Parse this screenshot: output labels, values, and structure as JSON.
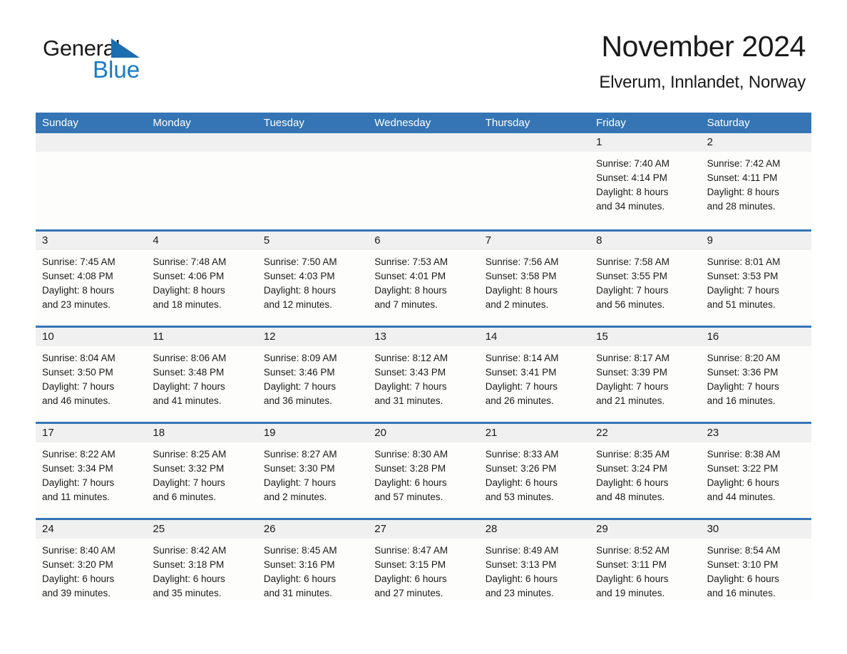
{
  "brand": {
    "name_part1": "General",
    "name_part2": "Blue",
    "accent_color": "#1b7ac4",
    "triangle_color": "#1b6fb0"
  },
  "header": {
    "title": "November 2024",
    "subtitle": "Elverum, Innlandet, Norway"
  },
  "theme": {
    "header_bar_color": "#3575b5",
    "daynum_band_color": "#f0f0f0",
    "cell_background": "#fdfdfc",
    "text_color": "#1a1a1a"
  },
  "weekdays": [
    "Sunday",
    "Monday",
    "Tuesday",
    "Wednesday",
    "Thursday",
    "Friday",
    "Saturday"
  ],
  "weeks": [
    [
      {
        "day": "",
        "lines": []
      },
      {
        "day": "",
        "lines": []
      },
      {
        "day": "",
        "lines": []
      },
      {
        "day": "",
        "lines": []
      },
      {
        "day": "",
        "lines": []
      },
      {
        "day": "1",
        "lines": [
          "Sunrise: 7:40 AM",
          "Sunset: 4:14 PM",
          "Daylight: 8 hours",
          "and 34 minutes."
        ]
      },
      {
        "day": "2",
        "lines": [
          "Sunrise: 7:42 AM",
          "Sunset: 4:11 PM",
          "Daylight: 8 hours",
          "and 28 minutes."
        ]
      }
    ],
    [
      {
        "day": "3",
        "lines": [
          "Sunrise: 7:45 AM",
          "Sunset: 4:08 PM",
          "Daylight: 8 hours",
          "and 23 minutes."
        ]
      },
      {
        "day": "4",
        "lines": [
          "Sunrise: 7:48 AM",
          "Sunset: 4:06 PM",
          "Daylight: 8 hours",
          "and 18 minutes."
        ]
      },
      {
        "day": "5",
        "lines": [
          "Sunrise: 7:50 AM",
          "Sunset: 4:03 PM",
          "Daylight: 8 hours",
          "and 12 minutes."
        ]
      },
      {
        "day": "6",
        "lines": [
          "Sunrise: 7:53 AM",
          "Sunset: 4:01 PM",
          "Daylight: 8 hours",
          "and 7 minutes."
        ]
      },
      {
        "day": "7",
        "lines": [
          "Sunrise: 7:56 AM",
          "Sunset: 3:58 PM",
          "Daylight: 8 hours",
          "and 2 minutes."
        ]
      },
      {
        "day": "8",
        "lines": [
          "Sunrise: 7:58 AM",
          "Sunset: 3:55 PM",
          "Daylight: 7 hours",
          "and 56 minutes."
        ]
      },
      {
        "day": "9",
        "lines": [
          "Sunrise: 8:01 AM",
          "Sunset: 3:53 PM",
          "Daylight: 7 hours",
          "and 51 minutes."
        ]
      }
    ],
    [
      {
        "day": "10",
        "lines": [
          "Sunrise: 8:04 AM",
          "Sunset: 3:50 PM",
          "Daylight: 7 hours",
          "and 46 minutes."
        ]
      },
      {
        "day": "11",
        "lines": [
          "Sunrise: 8:06 AM",
          "Sunset: 3:48 PM",
          "Daylight: 7 hours",
          "and 41 minutes."
        ]
      },
      {
        "day": "12",
        "lines": [
          "Sunrise: 8:09 AM",
          "Sunset: 3:46 PM",
          "Daylight: 7 hours",
          "and 36 minutes."
        ]
      },
      {
        "day": "13",
        "lines": [
          "Sunrise: 8:12 AM",
          "Sunset: 3:43 PM",
          "Daylight: 7 hours",
          "and 31 minutes."
        ]
      },
      {
        "day": "14",
        "lines": [
          "Sunrise: 8:14 AM",
          "Sunset: 3:41 PM",
          "Daylight: 7 hours",
          "and 26 minutes."
        ]
      },
      {
        "day": "15",
        "lines": [
          "Sunrise: 8:17 AM",
          "Sunset: 3:39 PM",
          "Daylight: 7 hours",
          "and 21 minutes."
        ]
      },
      {
        "day": "16",
        "lines": [
          "Sunrise: 8:20 AM",
          "Sunset: 3:36 PM",
          "Daylight: 7 hours",
          "and 16 minutes."
        ]
      }
    ],
    [
      {
        "day": "17",
        "lines": [
          "Sunrise: 8:22 AM",
          "Sunset: 3:34 PM",
          "Daylight: 7 hours",
          "and 11 minutes."
        ]
      },
      {
        "day": "18",
        "lines": [
          "Sunrise: 8:25 AM",
          "Sunset: 3:32 PM",
          "Daylight: 7 hours",
          "and 6 minutes."
        ]
      },
      {
        "day": "19",
        "lines": [
          "Sunrise: 8:27 AM",
          "Sunset: 3:30 PM",
          "Daylight: 7 hours",
          "and 2 minutes."
        ]
      },
      {
        "day": "20",
        "lines": [
          "Sunrise: 8:30 AM",
          "Sunset: 3:28 PM",
          "Daylight: 6 hours",
          "and 57 minutes."
        ]
      },
      {
        "day": "21",
        "lines": [
          "Sunrise: 8:33 AM",
          "Sunset: 3:26 PM",
          "Daylight: 6 hours",
          "and 53 minutes."
        ]
      },
      {
        "day": "22",
        "lines": [
          "Sunrise: 8:35 AM",
          "Sunset: 3:24 PM",
          "Daylight: 6 hours",
          "and 48 minutes."
        ]
      },
      {
        "day": "23",
        "lines": [
          "Sunrise: 8:38 AM",
          "Sunset: 3:22 PM",
          "Daylight: 6 hours",
          "and 44 minutes."
        ]
      }
    ],
    [
      {
        "day": "24",
        "lines": [
          "Sunrise: 8:40 AM",
          "Sunset: 3:20 PM",
          "Daylight: 6 hours",
          "and 39 minutes."
        ]
      },
      {
        "day": "25",
        "lines": [
          "Sunrise: 8:42 AM",
          "Sunset: 3:18 PM",
          "Daylight: 6 hours",
          "and 35 minutes."
        ]
      },
      {
        "day": "26",
        "lines": [
          "Sunrise: 8:45 AM",
          "Sunset: 3:16 PM",
          "Daylight: 6 hours",
          "and 31 minutes."
        ]
      },
      {
        "day": "27",
        "lines": [
          "Sunrise: 8:47 AM",
          "Sunset: 3:15 PM",
          "Daylight: 6 hours",
          "and 27 minutes."
        ]
      },
      {
        "day": "28",
        "lines": [
          "Sunrise: 8:49 AM",
          "Sunset: 3:13 PM",
          "Daylight: 6 hours",
          "and 23 minutes."
        ]
      },
      {
        "day": "29",
        "lines": [
          "Sunrise: 8:52 AM",
          "Sunset: 3:11 PM",
          "Daylight: 6 hours",
          "and 19 minutes."
        ]
      },
      {
        "day": "30",
        "lines": [
          "Sunrise: 8:54 AM",
          "Sunset: 3:10 PM",
          "Daylight: 6 hours",
          "and 16 minutes."
        ]
      }
    ]
  ]
}
